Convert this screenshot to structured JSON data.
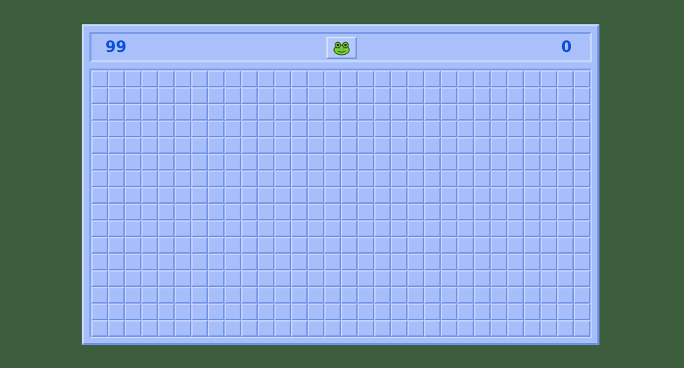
{
  "game": {
    "mines_remaining": "99",
    "timer": "0",
    "face_icon": "frog-face-icon",
    "board": {
      "rows": 16,
      "cols": 30,
      "state": "all-covered"
    }
  },
  "colors": {
    "background": "#3d5e3d",
    "panel": "#a6befa",
    "counter_text": "#0e4fd8",
    "face": "#7cd13d"
  }
}
